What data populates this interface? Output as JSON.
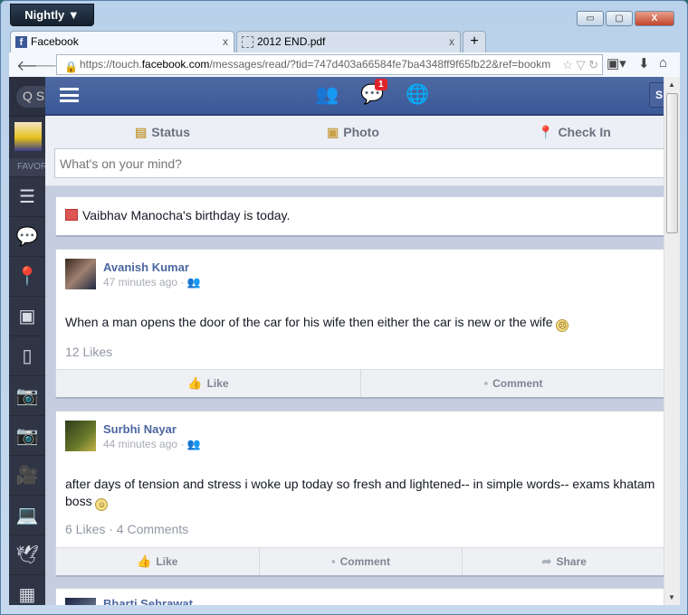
{
  "browser": {
    "app_button": "Nightly ▼",
    "window_controls": {
      "minimize": "▭",
      "maximize": "▢",
      "close": "X"
    },
    "tabs": [
      {
        "label": "Facebook",
        "close": "x"
      },
      {
        "label": "2012 END.pdf",
        "close": "x"
      }
    ],
    "new_tab": "+",
    "url_prefix": "https://touch.",
    "url_domain": "facebook.com",
    "url_suffix": "/messages/read/?tid=747d403a66584fe7ba4348ff9f65fb22&ref=bookm"
  },
  "sidebar": {
    "search_placeholder": "Q S",
    "favorites_label": "FAVORITES",
    "items": [
      "news-feed",
      "messages",
      "nearby",
      "photos",
      "notes",
      "camera",
      "camera",
      "video",
      "laptop",
      "dove",
      "calculator"
    ]
  },
  "header": {
    "message_badge": "1",
    "search_button": "S"
  },
  "composer": {
    "tabs": [
      {
        "label": "Status"
      },
      {
        "label": "Photo"
      },
      {
        "label": "Check In"
      }
    ],
    "placeholder": "What's on your mind?"
  },
  "birthday": {
    "text": "Vaibhav Manocha's birthday is today."
  },
  "posts": [
    {
      "author": "Avanish Kumar",
      "time": "47 minutes ago ·",
      "text": "When a man opens the door of the car for his wife then either the car is new or the wife",
      "stats": "12 Likes",
      "actions": [
        "Like",
        "Comment"
      ]
    },
    {
      "author": "Surbhi Nayar",
      "time": "44 minutes ago ·",
      "text": "after days of tension and stress i woke up today so fresh and lightened-- in simple words-- exams khatam boss",
      "stats": "6 Likes · 4 Comments",
      "actions": [
        "Like",
        "Comment",
        "Share"
      ]
    },
    {
      "author": "Bharti Sehrawat"
    }
  ],
  "colors": {
    "fb_blue": "#3b5998",
    "sidebar": "#2f3545",
    "feed_bg": "#c5cde0",
    "badge": "#e0242c"
  }
}
